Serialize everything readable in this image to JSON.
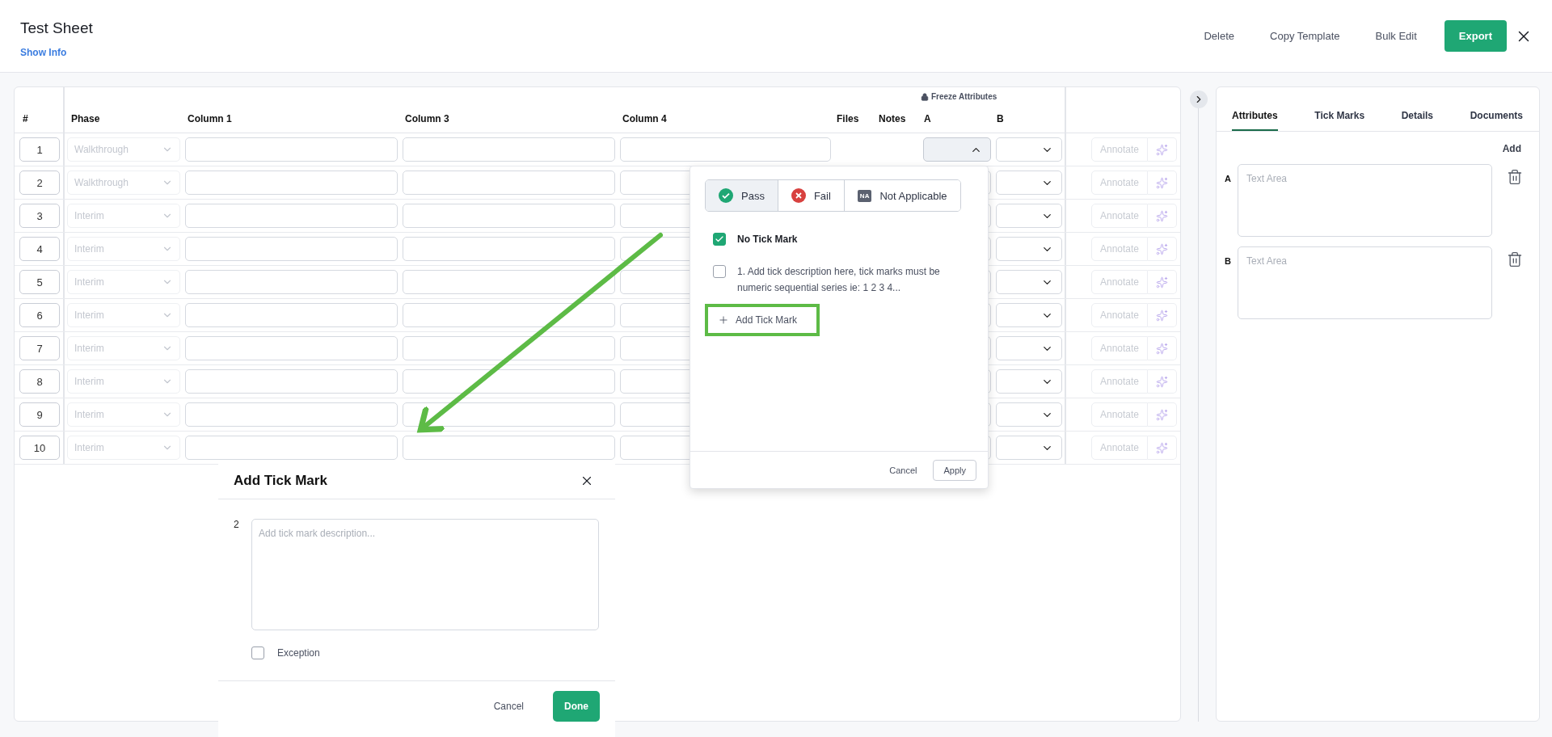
{
  "header": {
    "title": "Test Sheet",
    "info_link": "Show Info",
    "actions": [
      "Delete",
      "Copy Template",
      "Bulk Edit"
    ],
    "export": "Export"
  },
  "table": {
    "freeze_label": "Freeze Attributes",
    "columns": [
      "#",
      "Phase",
      "Column 1",
      "Column 3",
      "Column 4",
      "Files",
      "Notes",
      "A",
      "B"
    ],
    "rows": [
      {
        "number": "1",
        "phase": "Walkthrough",
        "a_expanded": true,
        "annotate": "Annotate"
      },
      {
        "number": "2",
        "phase": "Walkthrough",
        "a_expanded": false,
        "annotate": "Annotate"
      },
      {
        "number": "3",
        "phase": "Interim",
        "a_expanded": false,
        "annotate": "Annotate"
      },
      {
        "number": "4",
        "phase": "Interim",
        "a_expanded": false,
        "annotate": "Annotate"
      },
      {
        "number": "5",
        "phase": "Interim",
        "a_expanded": false,
        "annotate": "Annotate"
      },
      {
        "number": "6",
        "phase": "Interim",
        "a_expanded": false,
        "annotate": "Annotate"
      },
      {
        "number": "7",
        "phase": "Interim",
        "a_expanded": false,
        "annotate": "Annotate"
      },
      {
        "number": "8",
        "phase": "Interim",
        "a_expanded": false,
        "annotate": "Annotate"
      },
      {
        "number": "9",
        "phase": "Interim",
        "a_expanded": false,
        "annotate": "Annotate"
      },
      {
        "number": "10",
        "phase": "Interim",
        "a_expanded": false,
        "annotate": "Annotate"
      }
    ]
  },
  "popup": {
    "results": [
      {
        "kind": "pass",
        "label": "Pass",
        "selected": true
      },
      {
        "kind": "fail",
        "label": "Fail",
        "selected": false
      },
      {
        "kind": "na",
        "badge": "NA",
        "label": "Not Applicable",
        "selected": false
      }
    ],
    "tick_marks": [
      {
        "label": "No Tick Mark",
        "checked": true
      },
      {
        "number": "1.",
        "label": "Add tick description here, tick marks must be numeric sequential series ie: 1 2 3 4...",
        "checked": false
      }
    ],
    "add": "Add Tick Mark",
    "cancel": "Cancel",
    "apply": "Apply"
  },
  "modal": {
    "title": "Add Tick Mark",
    "number": "2",
    "placeholder": "Add tick mark description...",
    "exception": {
      "label": "Exception",
      "checked": false
    },
    "cancel": "Cancel",
    "done": "Done"
  },
  "side_panel": {
    "tabs": [
      {
        "label": "Attributes",
        "selected": true
      },
      {
        "label": "Tick Marks",
        "selected": false
      },
      {
        "label": "Details",
        "selected": false
      },
      {
        "label": "Documents",
        "selected": false
      }
    ],
    "add": "Add",
    "attributes": [
      {
        "label": "A",
        "placeholder": "Text Area"
      },
      {
        "label": "B",
        "placeholder": "Text Area"
      }
    ]
  }
}
